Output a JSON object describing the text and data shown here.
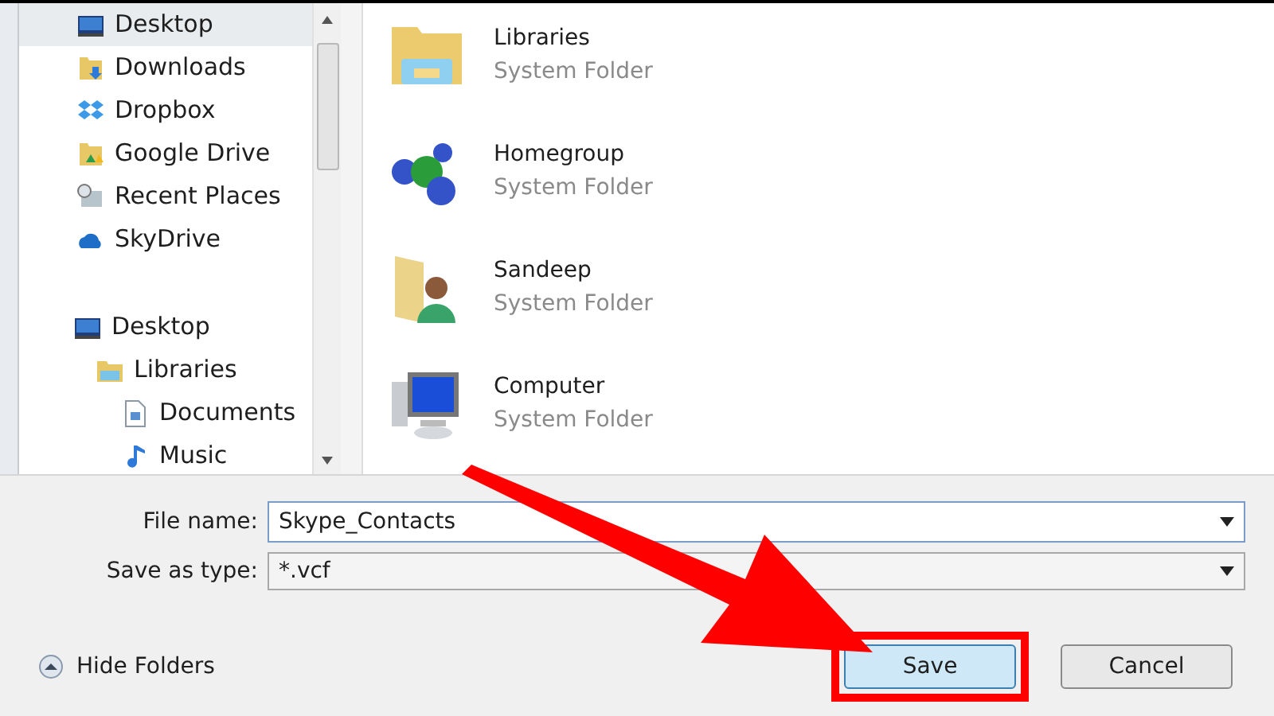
{
  "nav": {
    "favorites": [
      {
        "label": "Desktop",
        "kind": "desktop",
        "selected": true
      },
      {
        "label": "Downloads",
        "kind": "downloads",
        "selected": false
      },
      {
        "label": "Dropbox",
        "kind": "dropbox",
        "selected": false
      },
      {
        "label": "Google Drive",
        "kind": "gdrive",
        "selected": false
      },
      {
        "label": "Recent Places",
        "kind": "recent",
        "selected": false
      },
      {
        "label": "SkyDrive",
        "kind": "cloud",
        "selected": false
      }
    ],
    "tree": [
      {
        "label": "Desktop",
        "kind": "desktop",
        "children": [
          {
            "label": "Libraries",
            "kind": "libraries",
            "children": [
              {
                "label": "Documents",
                "kind": "document"
              },
              {
                "label": "Music",
                "kind": "music"
              }
            ]
          }
        ]
      }
    ]
  },
  "items": [
    {
      "name": "Libraries",
      "type": "System Folder",
      "kind": "libraries"
    },
    {
      "name": "Homegroup",
      "type": "System Folder",
      "kind": "homegroup"
    },
    {
      "name": "Sandeep",
      "type": "System Folder",
      "kind": "user"
    },
    {
      "name": "Computer",
      "type": "System Folder",
      "kind": "computer"
    }
  ],
  "form": {
    "file_name_label": "File name:",
    "file_name": "Skype_Contacts",
    "type_label": "Save as type:",
    "type_value": "*.vcf"
  },
  "hide_folders": "Hide Folders",
  "buttons": [
    {
      "label": "Save",
      "highlighted": true
    },
    {
      "label": "Cancel",
      "highlighted": false
    }
  ]
}
